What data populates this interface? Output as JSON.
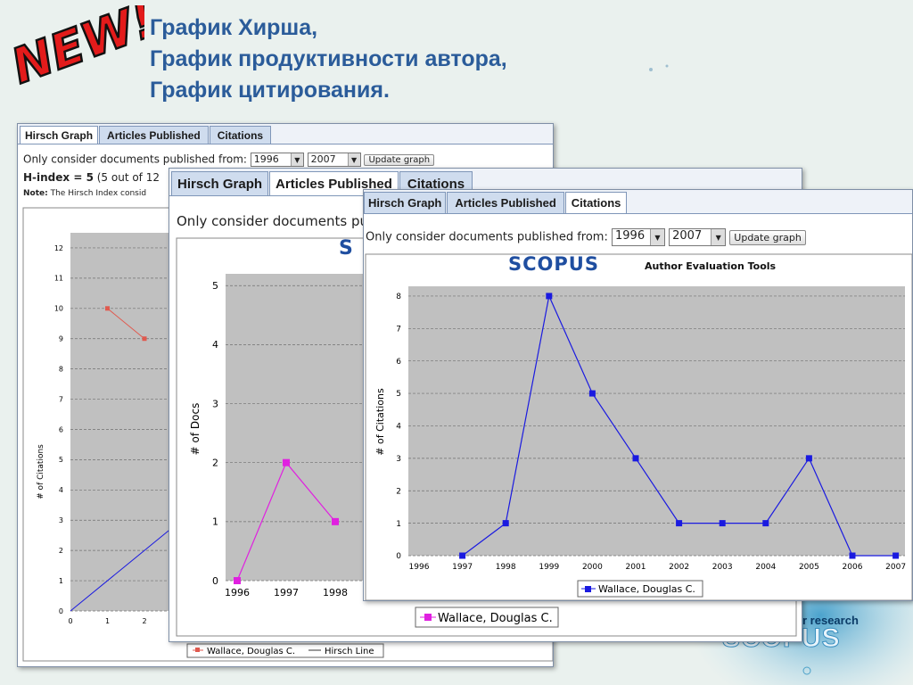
{
  "heading": {
    "line1": "График Хирша,",
    "line2": "График продуктивности автора,",
    "line3": "График цитирования."
  },
  "badge": {
    "text": "NEW!",
    "color": "#e31b1b"
  },
  "background_brand": {
    "text": "r research",
    "logo": "SCOPUS"
  },
  "tabs": [
    "Hirsch Graph",
    "Articles Published",
    "Citations"
  ],
  "colors": {
    "hirsch": "#e05a4f",
    "articles": "#e020e0",
    "citations": "#1a1ae0",
    "plot_bg": "#c0c0c0",
    "heading": "#2b5c9a"
  },
  "panel_hirsch": {
    "active_tab": 0,
    "filter_label": "Only consider documents published from:",
    "from_value": "1996",
    "to_value": "2007",
    "update_button": "Update graph",
    "hindex_label": "H-index = ",
    "hindex_value": "5",
    "hindex_rest": " (5 out of 12",
    "note_label": "Note:",
    "note_text": " The Hirsch Index consid",
    "legend_series": "Wallace, Douglas C.",
    "legend_line": "Hirsch Line"
  },
  "panel_articles": {
    "active_tab": 1,
    "filter_label": "Only consider documents pu",
    "logo": "S",
    "legend": "Wallace, Douglas C."
  },
  "panel_citations": {
    "active_tab": 2,
    "filter_label": "Only consider documents published from:",
    "from_value": "1996",
    "to_value": "2007",
    "update_button": "Update graph",
    "logo": "SCOPUS",
    "logo_sub": "Author Evaluation Tools",
    "legend": "Wallace, Douglas C."
  },
  "chart_data": [
    {
      "type": "line",
      "ylabel": "# of Citations",
      "ylim": [
        0,
        12.5
      ],
      "yticks": [
        0,
        1,
        2,
        3,
        4,
        5,
        6,
        7,
        8,
        9,
        10,
        11,
        12
      ],
      "xticks": [
        0,
        1,
        2
      ],
      "series": [
        {
          "name": "Wallace, Douglas C.",
          "x": [
            1,
            2
          ],
          "values": [
            10,
            9
          ]
        },
        {
          "name": "Hirsch Line",
          "x": [
            0,
            2.7
          ],
          "values": [
            0,
            2.7
          ]
        }
      ]
    },
    {
      "type": "line",
      "ylabel": "# of Docs",
      "ylim": [
        0,
        5.2
      ],
      "yticks": [
        0,
        1,
        2,
        3,
        4,
        5
      ],
      "categories": [
        "1996",
        "1997",
        "1998"
      ],
      "series": [
        {
          "name": "Wallace, Douglas C.",
          "values": [
            0,
            2,
            1
          ]
        }
      ]
    },
    {
      "type": "line",
      "title": "Author Evaluation Tools",
      "ylabel": "# of Citations",
      "ylim": [
        0,
        8.3
      ],
      "yticks": [
        0,
        1,
        2,
        3,
        4,
        5,
        6,
        7,
        8
      ],
      "categories": [
        "1996",
        "1997",
        "1998",
        "1999",
        "2000",
        "2001",
        "2002",
        "2003",
        "2004",
        "2005",
        "2006",
        "2007"
      ],
      "series": [
        {
          "name": "Wallace, Douglas C.",
          "values": [
            null,
            0,
            1,
            8,
            5,
            3,
            1,
            1,
            1,
            3,
            0,
            0
          ]
        }
      ],
      "grid": true,
      "legend": "bottom"
    }
  ]
}
